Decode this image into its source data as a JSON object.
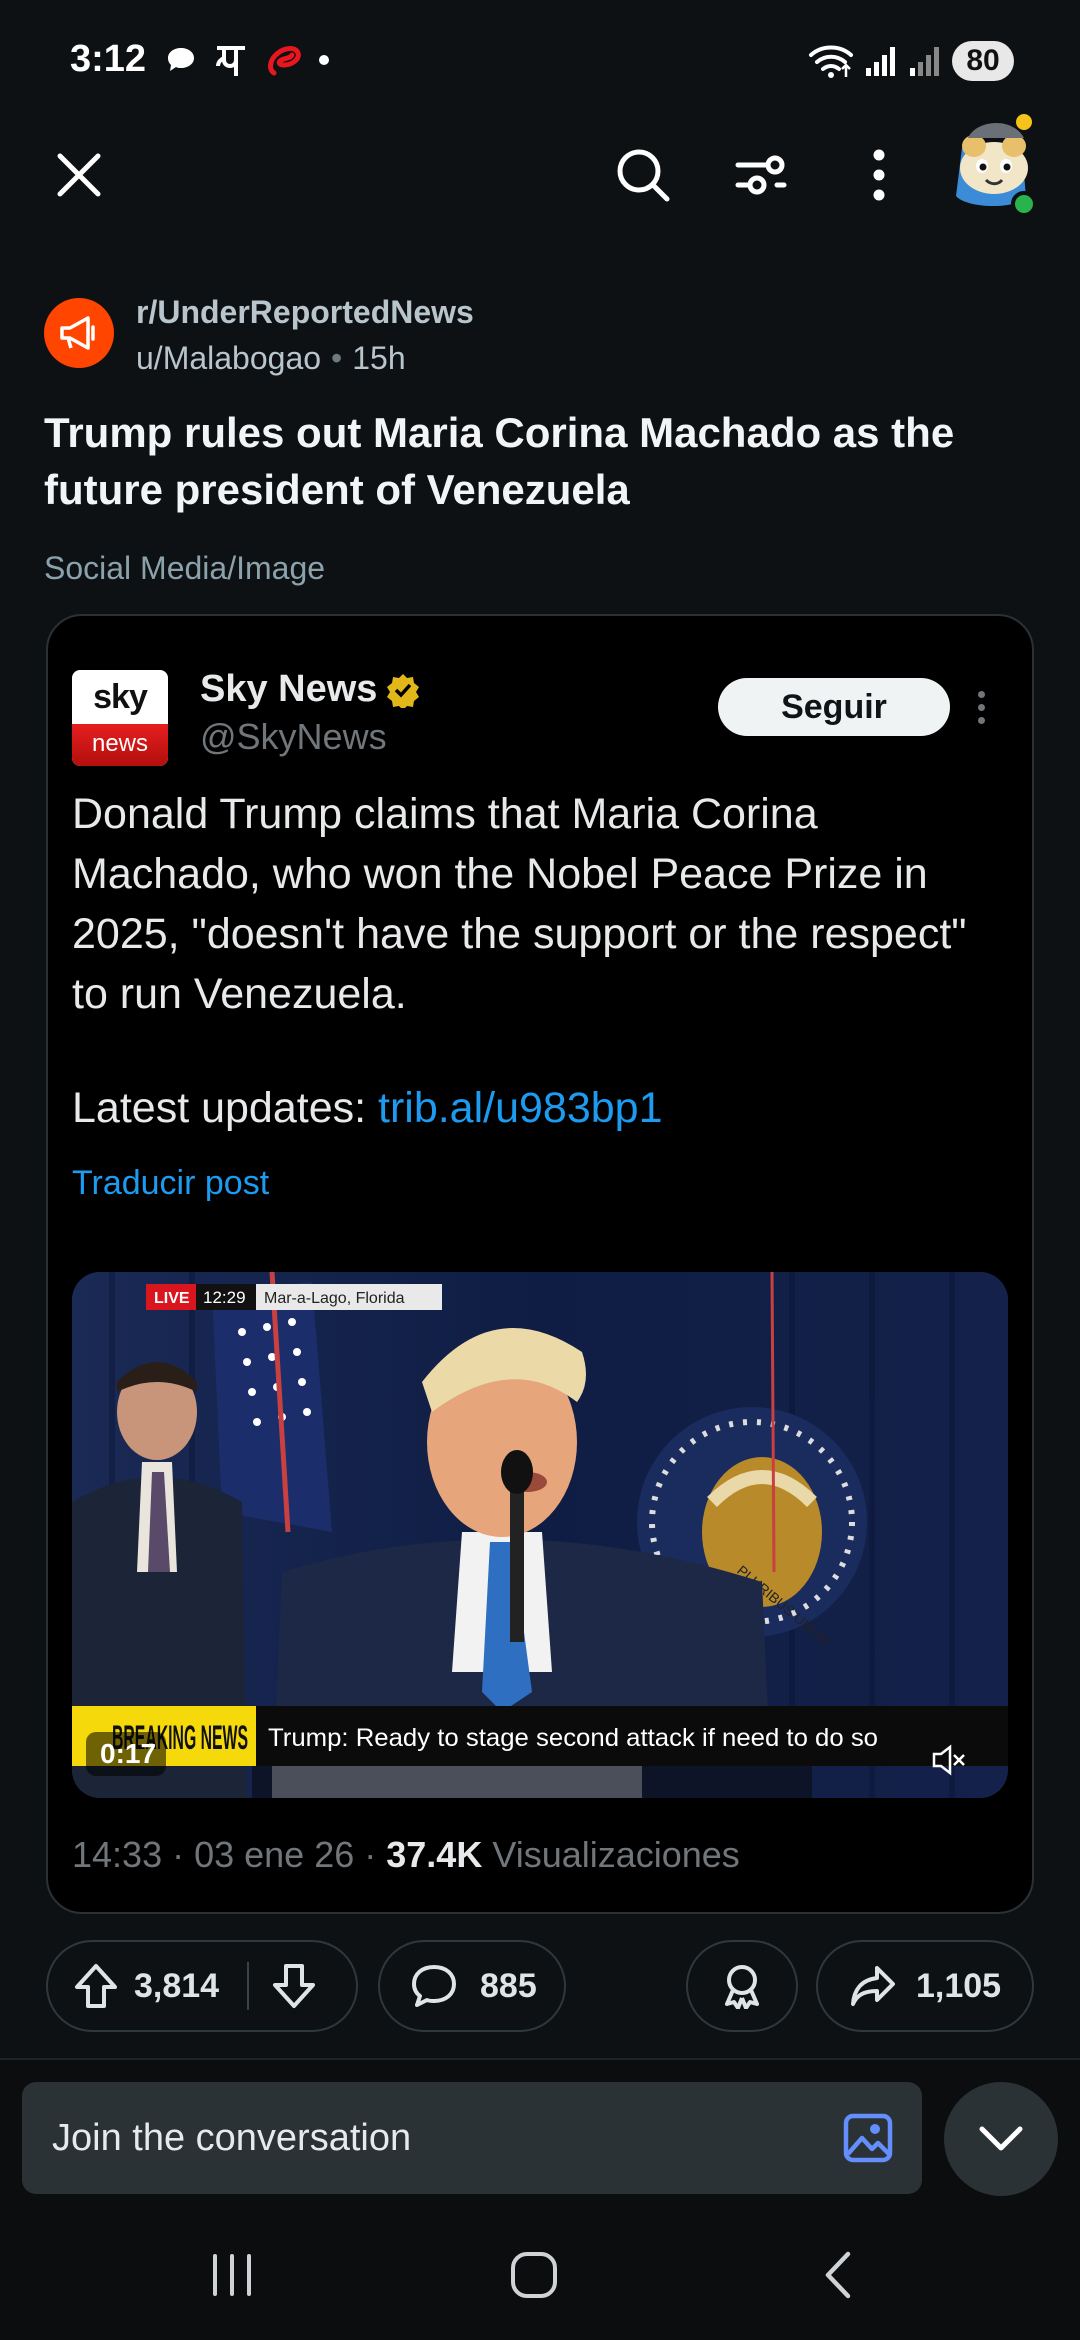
{
  "status_bar": {
    "time": "3:12",
    "battery": "80",
    "icons": [
      "chat-bubble-icon",
      "pe-app-icon",
      "airtel-icon",
      "dot-icon",
      "wifi-icon",
      "signal-icon",
      "signal-icon"
    ]
  },
  "top_nav": {
    "icons": [
      "close-icon",
      "search-icon",
      "filter-icon",
      "more-vertical-icon",
      "user-avatar"
    ]
  },
  "post": {
    "subreddit": "r/UnderReportedNews",
    "author": "u/Malabogao",
    "separator": "•",
    "age": "15h",
    "title": "Trump rules out Maria Corina Machado as the future president of Venezuela",
    "flair": "Social Media/Image"
  },
  "embed": {
    "logo_top": "sky",
    "logo_bottom": "news",
    "name": "Sky News",
    "handle": "@SkyNews",
    "follow_label": "Seguir",
    "text": "Donald Trump claims that Maria Corina Machado, who won the Nobel Peace Prize in 2025, \"doesn't have the support or the respect\" to run Venezuela.",
    "updates_label": "Latest updates: ",
    "updates_link": "trib.al/u983bp1",
    "translate": "Traducir post",
    "video": {
      "live": "LIVE",
      "clock": "12:29",
      "location": "Mar-a-Lago, Florida",
      "breaking": "BREAKING NEWS",
      "ticker": "Trump: Ready to stage second attack if need to do so",
      "duration": "0:17",
      "seal_text": "PLURIBUS UNUM"
    },
    "time": "14:33",
    "dot1": "·",
    "date": "03 ene 26",
    "dot2": "·",
    "views_count": "37.4K",
    "views_label": "Visualizaciones"
  },
  "actions": {
    "upvotes": "3,814",
    "comments": "885",
    "shares": "1,105"
  },
  "comment_bar": {
    "placeholder": "Join the conversation"
  },
  "colors": {
    "background": "#0e1113",
    "reddit_orange": "#ff4500",
    "twitter_blue": "#1d9bf0",
    "breaking_yellow": "#f5d90a"
  }
}
